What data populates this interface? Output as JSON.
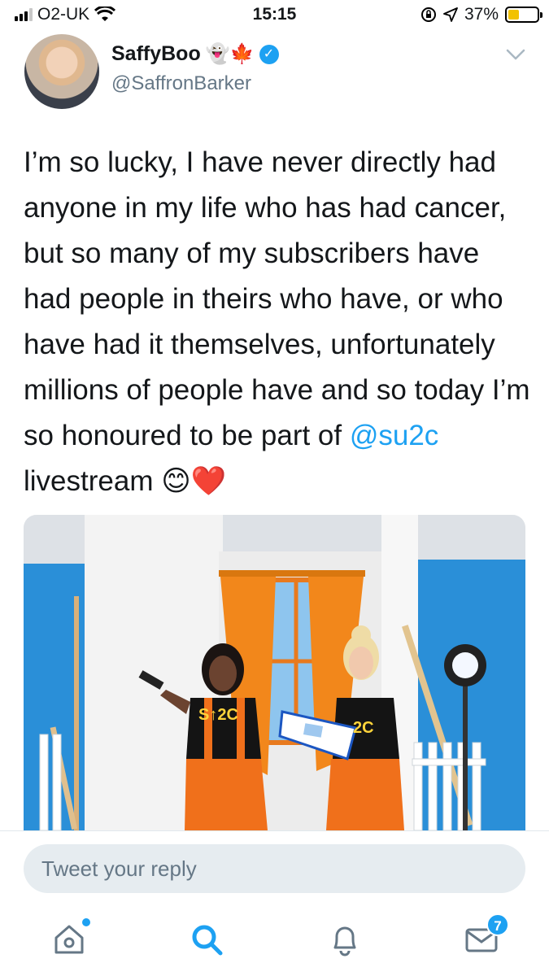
{
  "status_bar": {
    "carrier": "O2-UK",
    "time": "15:15",
    "battery_percent": "37%",
    "battery_level": 0.37
  },
  "tweet": {
    "author_name": "SaffyBoo",
    "name_emojis": "👻🍁",
    "verified": true,
    "handle": "@SaffronBarker",
    "text_before_mention": "I’m so lucky, I have never directly had anyone in my life who has had cancer, but so many of my subscribers have had people in theirs who have, or who have had it themselves, unfortunately millions of people have and so today I’m so honoured to be part of ",
    "mention": "@su2c",
    "text_after_mention": " livestream 😊❤️",
    "image_shirt_text_left": "S↑2C",
    "image_shirt_text_right": "2C"
  },
  "reply": {
    "placeholder": "Tweet your reply"
  },
  "tab_bar": {
    "home_icon": "home-icon",
    "search_icon": "search-icon",
    "notifications_icon": "bell-icon",
    "messages_icon": "mail-icon",
    "messages_badge": "7"
  },
  "colors": {
    "accent": "#1da1f2",
    "secondary_text": "#657786",
    "reply_bg": "#e6ecf0"
  }
}
